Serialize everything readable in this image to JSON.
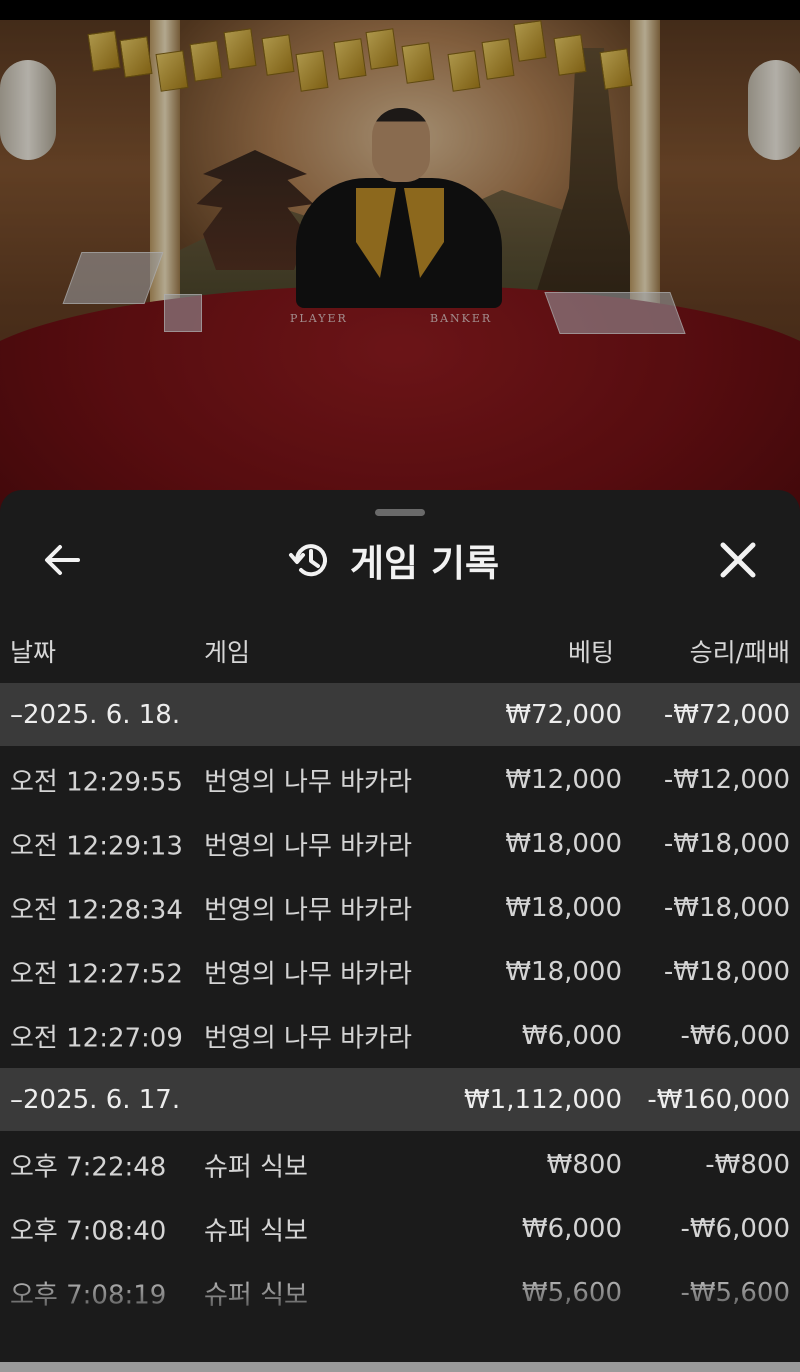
{
  "sheet": {
    "title": "게임 기록",
    "icons": {
      "back": "arrow-left-icon",
      "history": "history-icon",
      "close": "close-icon"
    }
  },
  "columns": {
    "date": "날짜",
    "game": "게임",
    "bet": "베팅",
    "result": "승리/패배"
  },
  "table_labels": {
    "player": "PLAYER",
    "banker": "BANKER"
  },
  "groups": [
    {
      "date": "–2025. 6. 18.",
      "bet_total": "₩72,000",
      "result_total": "-₩72,000",
      "rows": [
        {
          "time": "오전 12:29:55",
          "game": "번영의 나무 바카라",
          "bet": "₩12,000",
          "result": "-₩12,000"
        },
        {
          "time": "오전 12:29:13",
          "game": "번영의 나무 바카라",
          "bet": "₩18,000",
          "result": "-₩18,000"
        },
        {
          "time": "오전 12:28:34",
          "game": "번영의 나무 바카라",
          "bet": "₩18,000",
          "result": "-₩18,000"
        },
        {
          "time": "오전 12:27:52",
          "game": "번영의 나무 바카라",
          "bet": "₩18,000",
          "result": "-₩18,000"
        },
        {
          "time": "오전 12:27:09",
          "game": "번영의 나무 바카라",
          "bet": "₩6,000",
          "result": "-₩6,000"
        }
      ]
    },
    {
      "date": "–2025. 6. 17.",
      "bet_total": "₩1,112,000",
      "result_total": "-₩160,000",
      "rows": [
        {
          "time": "오후 7:22:48",
          "game": "슈퍼 식보",
          "bet": "₩800",
          "result": "-₩800"
        },
        {
          "time": "오후 7:08:40",
          "game": "슈퍼 식보",
          "bet": "₩6,000",
          "result": "-₩6,000"
        },
        {
          "time": "오후 7:08:19",
          "game": "슈퍼 식보",
          "bet": "₩5,600",
          "result": "-₩5,600"
        }
      ]
    }
  ],
  "colors": {
    "sheet_bg": "#1b1b1b",
    "date_row_bg": "#3a3a3a",
    "text": "#d4d4d4",
    "table_felt": "#8a1a1e"
  }
}
